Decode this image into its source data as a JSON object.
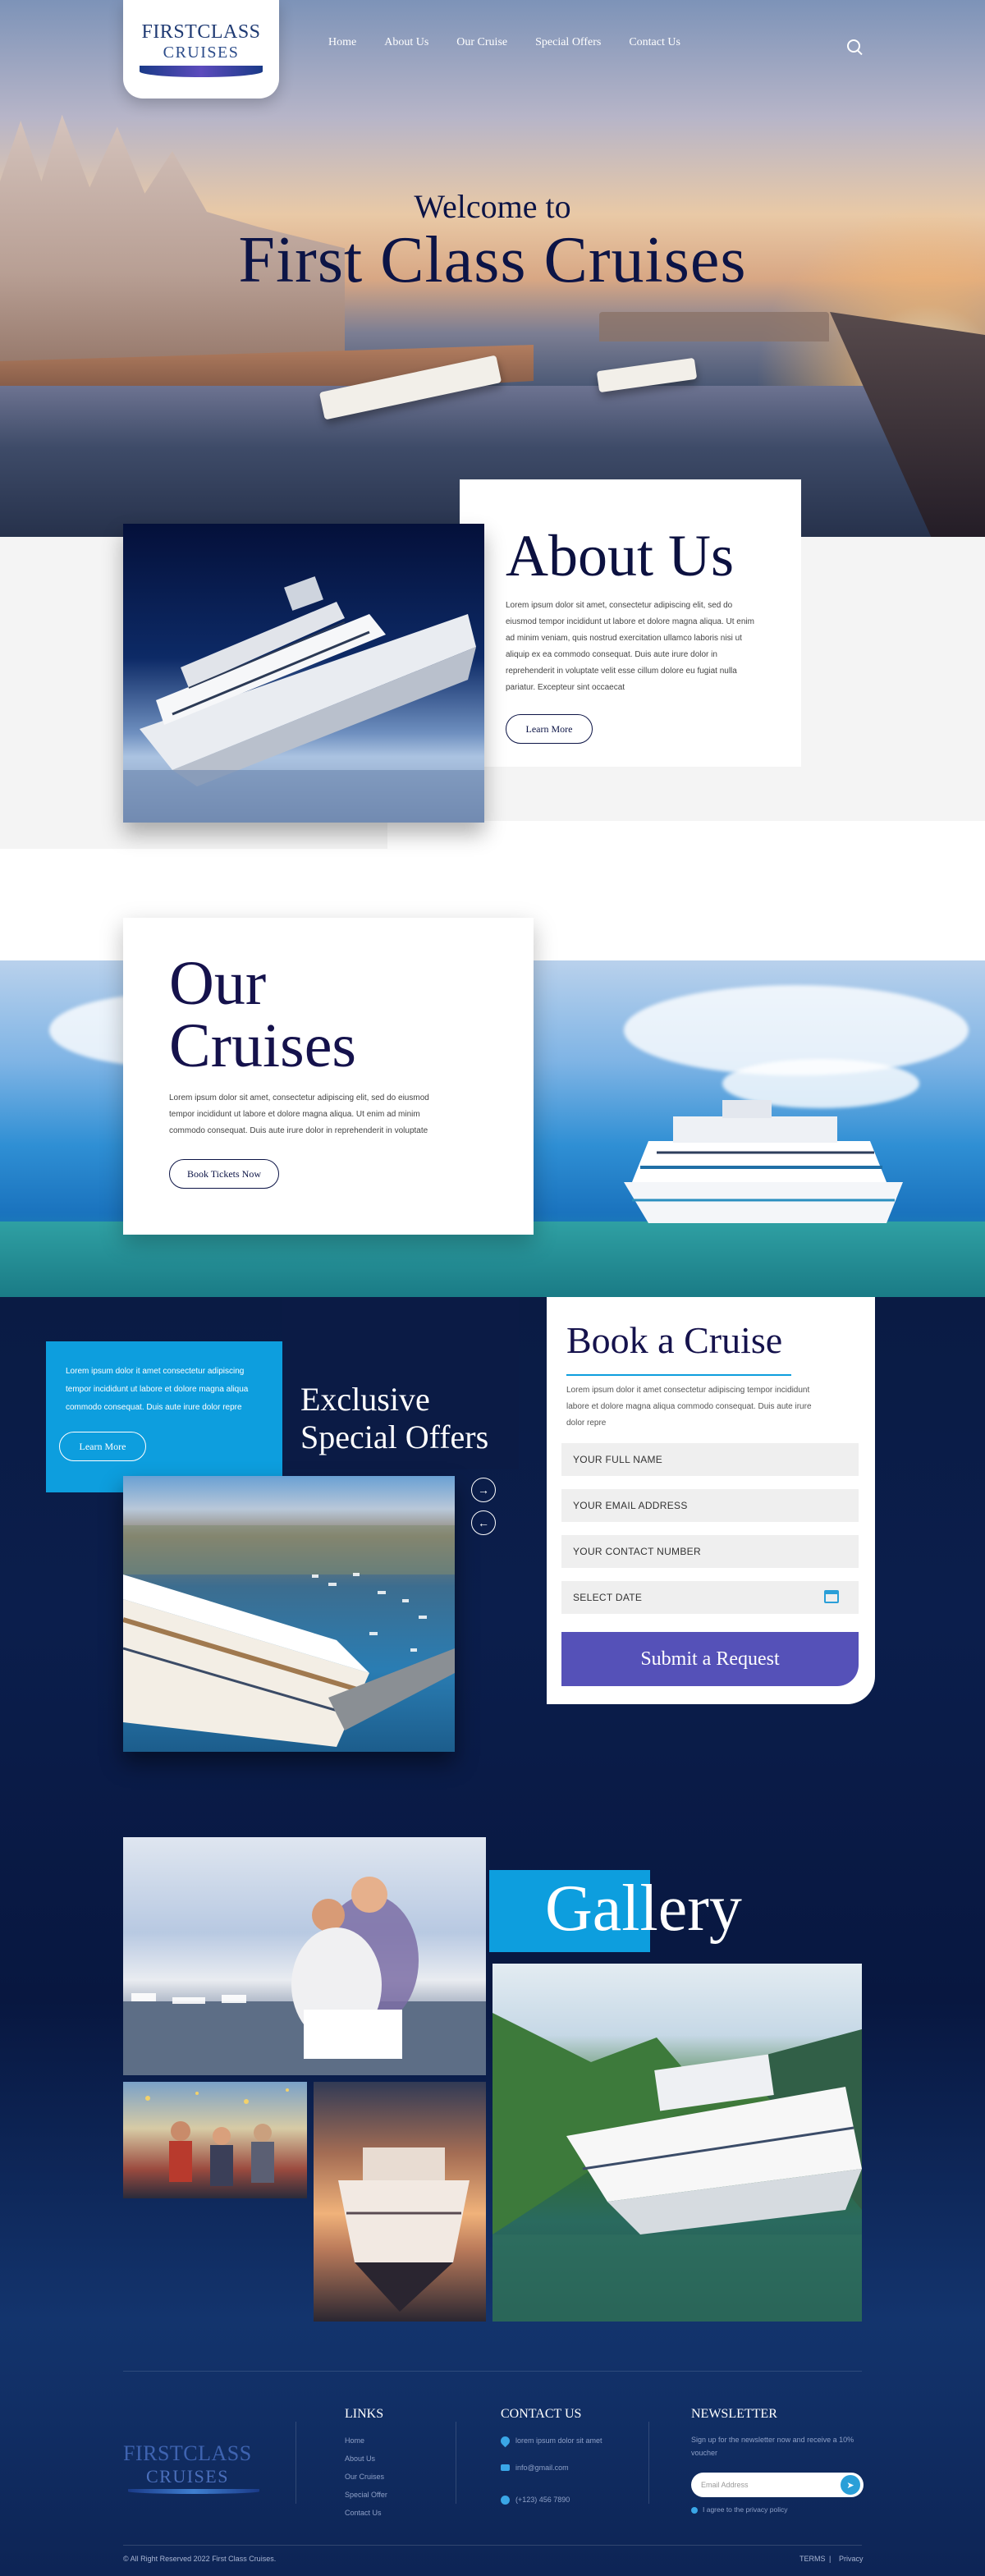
{
  "brand": {
    "line1": "FIRSTCLASS",
    "line2": "CRUISES"
  },
  "nav": {
    "items": [
      "Home",
      "About Us",
      "Our Cruise",
      "Special Offers",
      "Contact Us"
    ]
  },
  "hero": {
    "welcome": "Welcome to",
    "title": "First Class Cruises"
  },
  "about": {
    "title": "About Us",
    "text": "Lorem ipsum dolor sit amet, consectetur adipiscing elit, sed do eiusmod tempor incididunt ut labore et dolore magna aliqua. Ut enim ad minim veniam, quis nostrud exercitation ullamco laboris nisi ut aliquip ex ea commodo consequat. Duis aute irure dolor in reprehenderit in voluptate velit esse cillum dolore eu fugiat nulla pariatur. Excepteur sint occaecat",
    "button": "Learn More"
  },
  "cruises": {
    "title_line1": "Our",
    "title_line2": "Cruises",
    "text": "Lorem ipsum dolor sit amet, consectetur adipiscing elit, sed do eiusmod tempor incididunt ut labore et dolore magna aliqua. Ut enim ad minim commodo consequat. Duis aute irure dolor in reprehenderit in voluptate",
    "button": "Book Tickets Now"
  },
  "offers": {
    "text": "Lorem ipsum dolor it amet consectetur adipiscing tempor incididunt ut labore et dolore magna aliqua commodo consequat. Duis aute irure dolor repre",
    "button": "Learn More",
    "title_line1": "Exclusive",
    "title_line2": "Special Offers",
    "next_icon": "arrow-right-icon",
    "prev_icon": "arrow-left-icon"
  },
  "booking": {
    "title": "Book a Cruise",
    "text": "Lorem ipsum dolor it amet consectetur adipiscing tempor incididunt labore et dolore magna aliqua commodo consequat. Duis aute irure dolor repre",
    "fields": {
      "name": "YOUR FULL NAME",
      "email": "YOUR EMAIL ADDRESS",
      "phone": "YOUR CONTACT NUMBER",
      "date": "SELECT DATE"
    },
    "submit": "Submit a Request"
  },
  "gallery": {
    "title": "Gallery"
  },
  "footer": {
    "links_title": "LINKS",
    "links": [
      "Home",
      "About Us",
      "Our Cruises",
      "Special Offer",
      "Contact Us"
    ],
    "contact_title": "CONTACT US",
    "address": "lorem ipsum dolor sit amet",
    "email": "info@gmail.com",
    "phone": "(+123) 456 7890",
    "newsletter_title": "NEWSLETTER",
    "newsletter_text": "Sign up for the newsletter now and receive a 10% voucher",
    "newsletter_placeholder": "Email Address",
    "agree": "I agree to the privacy policy",
    "copyright": "© All Right Reserved 2022 First Class Cruises.",
    "terms": "TERMS",
    "divider": "|",
    "privacy": "Privacy"
  },
  "colors": {
    "navy": "#0c1446",
    "accent_blue": "#0d9ede",
    "submit_purple": "#5551b8",
    "dark_bg": "#0a1b44"
  }
}
